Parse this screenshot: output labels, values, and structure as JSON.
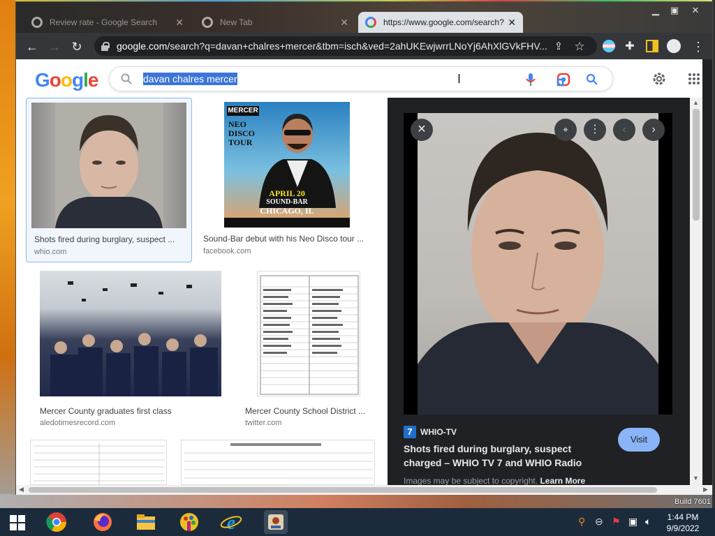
{
  "browser": {
    "tabs": [
      {
        "title": "Review rate - Google Search"
      },
      {
        "title": "New Tab"
      },
      {
        "title": "https://www.google.com/search?"
      }
    ],
    "url_domain": "google.com",
    "url_path": "/search?q=davan+chalres+mercer&tbm=isch&ved=2ahUKEwjwrrLNoYj6AhXlGVkFHV..."
  },
  "google": {
    "logo_text": "Google",
    "query": "davan chalres mercer"
  },
  "results": [
    {
      "caption": "Shots fired during burglary, suspect ...",
      "source": "whio.com"
    },
    {
      "caption": "Sound-Bar debut with his Neo Disco tour ...",
      "source": "facebook.com"
    },
    {
      "caption": "Mercer County graduates first class",
      "source": "aledotimesrecord.com"
    },
    {
      "caption": "Mercer County School District ...",
      "source": "twitter.com"
    }
  ],
  "poster": {
    "brand": "MERCER",
    "tour": "NEO DISCO TOUR",
    "date": "APRIL 20",
    "venue": "SOUND-BAR",
    "city": "CHICAGO, IL"
  },
  "preview": {
    "source_name": "WHIO-TV",
    "logo_char": "7",
    "title": "Shots fired during burglary, suspect charged – WHIO TV 7 and WHIO Radio",
    "visit_label": "Visit",
    "copyright": "Images may be subject to copyright.",
    "learn_more": "Learn More"
  },
  "desktop": {
    "build": "Build 7601"
  },
  "taskbar": {
    "time": "1:44 PM",
    "date": "9/9/2022"
  },
  "colors": {
    "accent": "#8ab4f8",
    "search_highlight": "#3b75d8",
    "panel": "#202124"
  }
}
